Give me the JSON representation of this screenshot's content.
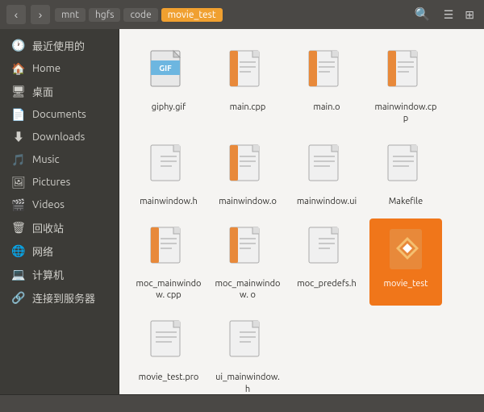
{
  "titlebar": {
    "back_label": "‹",
    "forward_label": "›",
    "breadcrumbs": [
      "mnt",
      "hgfs",
      "code",
      "movie_test"
    ],
    "search_icon": "🔍",
    "list_icon": "☰",
    "grid_icon": "⊞"
  },
  "sidebar": {
    "items": [
      {
        "id": "recent",
        "label": "最近使用的",
        "icon": "🕐"
      },
      {
        "id": "home",
        "label": "Home",
        "icon": "🏠"
      },
      {
        "id": "desktop",
        "label": "桌面",
        "icon": "🖥"
      },
      {
        "id": "documents",
        "label": "Documents",
        "icon": "📄"
      },
      {
        "id": "downloads",
        "label": "Downloads",
        "icon": "⬇"
      },
      {
        "id": "music",
        "label": "Music",
        "icon": "🎵"
      },
      {
        "id": "pictures",
        "label": "Pictures",
        "icon": "🖼"
      },
      {
        "id": "videos",
        "label": "Videos",
        "icon": "🎬"
      },
      {
        "id": "trash",
        "label": "回收站",
        "icon": "🗑"
      },
      {
        "id": "network",
        "label": "网络",
        "icon": "🌐"
      },
      {
        "id": "computer",
        "label": "计算机",
        "icon": "💻"
      },
      {
        "id": "connect",
        "label": "连接到服务器",
        "icon": "🔗"
      }
    ]
  },
  "files": [
    {
      "name": "giphy.gif",
      "type": "gif"
    },
    {
      "name": "main.cpp",
      "type": "cpp"
    },
    {
      "name": "main.o",
      "type": "obj"
    },
    {
      "name": "mainwindow.cpp",
      "type": "cpp"
    },
    {
      "name": "mainwindow.h",
      "type": "h"
    },
    {
      "name": "mainwindow.o",
      "type": "obj"
    },
    {
      "name": "mainwindow.ui",
      "type": "ui"
    },
    {
      "name": "Makefile",
      "type": "make"
    },
    {
      "name": "moc_mainwindow.\ncpp",
      "type": "cpp"
    },
    {
      "name": "moc_mainwindow.\no",
      "type": "obj"
    },
    {
      "name": "moc_predefs.h",
      "type": "h"
    },
    {
      "name": "movie_test",
      "type": "exec",
      "selected": true
    },
    {
      "name": "movie_test.pro",
      "type": "pro"
    },
    {
      "name": "ui_mainwindow.h",
      "type": "h"
    }
  ]
}
